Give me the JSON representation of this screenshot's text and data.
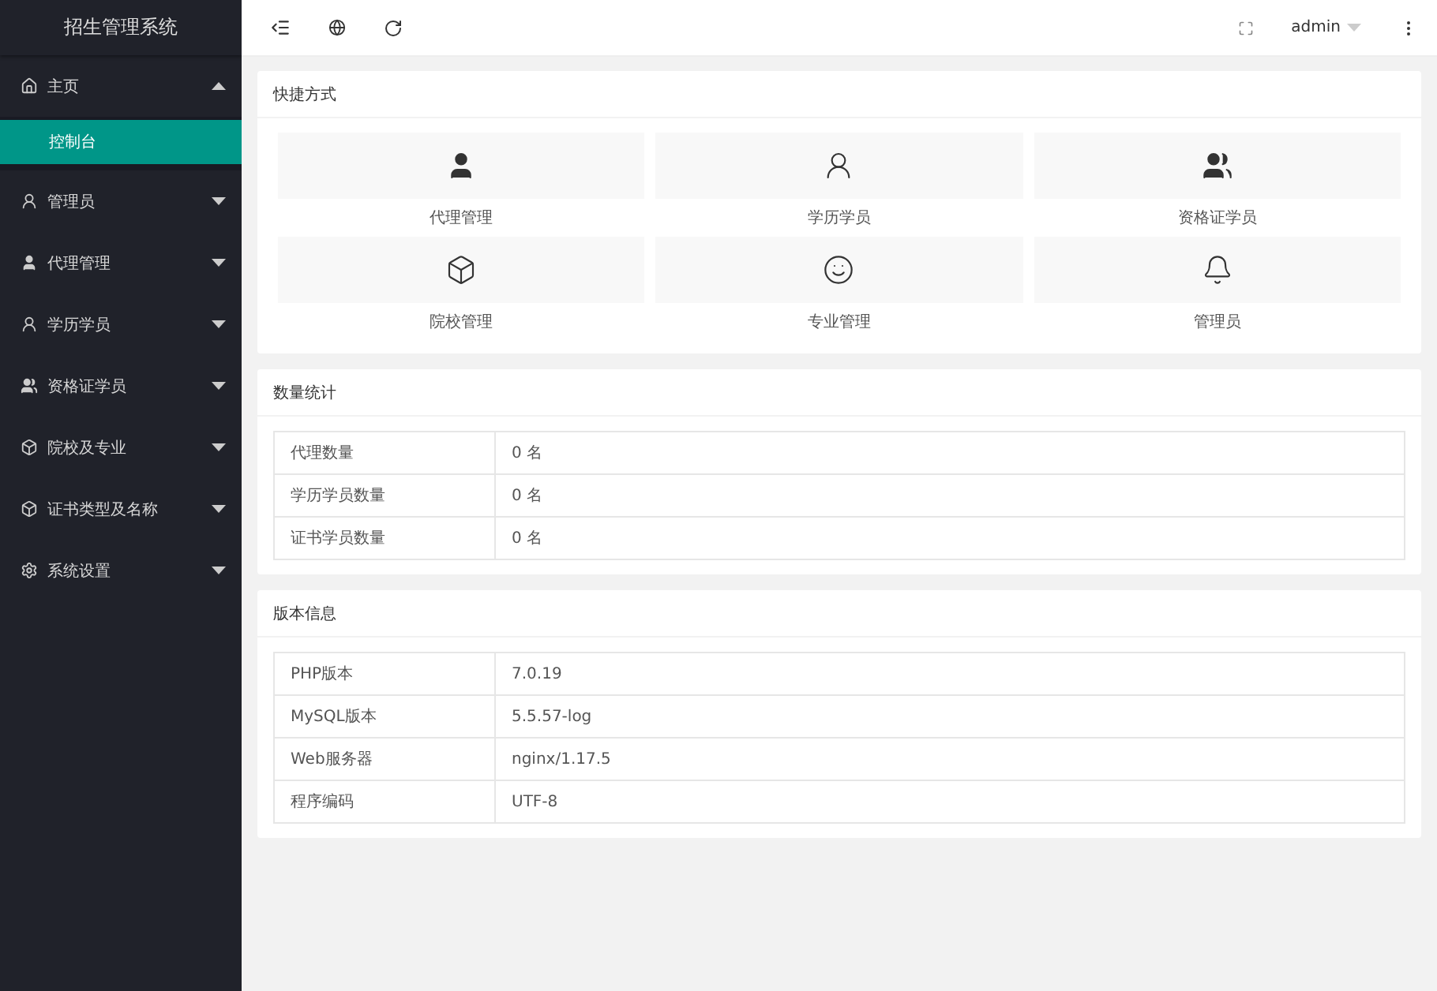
{
  "sidebar": {
    "title": "招生管理系统",
    "items": [
      {
        "label": "主页",
        "expanded": true,
        "children": [
          {
            "label": "控制台",
            "selected": true
          }
        ]
      },
      {
        "label": "管理员",
        "expanded": false
      },
      {
        "label": "代理管理",
        "expanded": false
      },
      {
        "label": "学历学员",
        "expanded": false
      },
      {
        "label": "资格证学员",
        "expanded": false
      },
      {
        "label": "院校及专业",
        "expanded": false
      },
      {
        "label": "证书类型及名称",
        "expanded": false
      },
      {
        "label": "系统设置",
        "expanded": false
      }
    ]
  },
  "header": {
    "user": "admin"
  },
  "shortcuts": {
    "title": "快捷方式",
    "items": [
      {
        "label": "代理管理"
      },
      {
        "label": "学历学员"
      },
      {
        "label": "资格证学员"
      },
      {
        "label": "院校管理"
      },
      {
        "label": "专业管理"
      },
      {
        "label": "管理员"
      }
    ]
  },
  "stats": {
    "title": "数量统计",
    "rows": [
      {
        "label": "代理数量",
        "value": "0 名"
      },
      {
        "label": "学历学员数量",
        "value": "0 名"
      },
      {
        "label": "证书学员数量",
        "value": "0 名"
      }
    ]
  },
  "version": {
    "title": "版本信息",
    "rows": [
      {
        "label": "PHP版本",
        "value": "7.0.19"
      },
      {
        "label": "MySQL版本",
        "value": "5.5.57-log"
      },
      {
        "label": "Web服务器",
        "value": "nginx/1.17.5"
      },
      {
        "label": "程序编码",
        "value": "UTF-8"
      }
    ]
  }
}
